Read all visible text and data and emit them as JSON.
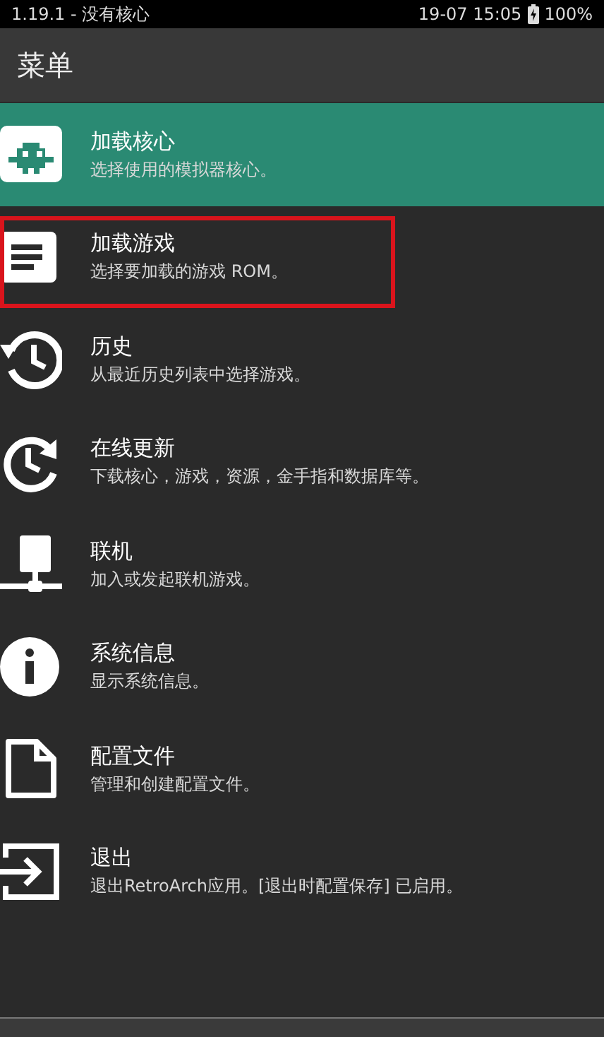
{
  "status_bar": {
    "left": "1.19.1 - 没有核心",
    "time": "19-07 15:05",
    "battery": "100%"
  },
  "header": {
    "title": "菜单"
  },
  "menu": {
    "items": [
      {
        "title": "加载核心",
        "subtitle": "选择使用的模拟器核心。",
        "selected": true,
        "highlighted": false
      },
      {
        "title": "加载游戏",
        "subtitle": "选择要加载的游戏 ROM。",
        "selected": false,
        "highlighted": true
      },
      {
        "title": "历史",
        "subtitle": "从最近历史列表中选择游戏。",
        "selected": false,
        "highlighted": false
      },
      {
        "title": "在线更新",
        "subtitle": "下载核心，游戏，资源，金手指和数据库等。",
        "selected": false,
        "highlighted": false
      },
      {
        "title": "联机",
        "subtitle": "加入或发起联机游戏。",
        "selected": false,
        "highlighted": false
      },
      {
        "title": "系统信息",
        "subtitle": "显示系统信息。",
        "selected": false,
        "highlighted": false
      },
      {
        "title": "配置文件",
        "subtitle": "管理和创建配置文件。",
        "selected": false,
        "highlighted": false
      },
      {
        "title": "退出",
        "subtitle": "退出RetroArch应用。[退出时配置保存] 已启用。",
        "selected": false,
        "highlighted": false
      }
    ]
  }
}
